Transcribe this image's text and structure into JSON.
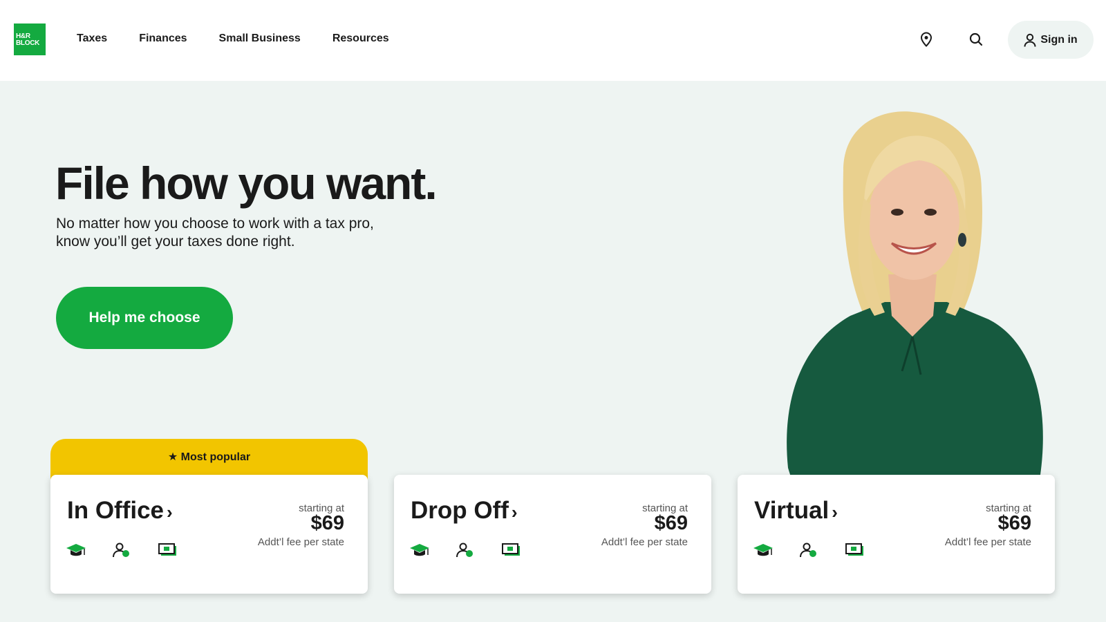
{
  "brand": {
    "logo_line1": "H&R",
    "logo_line2": "BLOCK",
    "green": "#14aa40",
    "yellow": "#f2c500",
    "hero_bg": "#eef4f2"
  },
  "nav": {
    "items": [
      "Taxes",
      "Finances",
      "Small Business",
      "Resources"
    ]
  },
  "header": {
    "location_icon": "location-pin-icon",
    "search_icon": "search-icon",
    "signin_label": "Sign in",
    "signin_icon": "user-icon"
  },
  "hero": {
    "headline": "File how you want.",
    "subtext": "No matter how you choose to work with a tax pro, know you’ll get your taxes done right.",
    "cta_label": "Help me choose"
  },
  "badge": {
    "label": "Most popular",
    "icon": "star-icon"
  },
  "cards": [
    {
      "title": "In Office",
      "starting": "starting at",
      "price": "$69",
      "fee": "Addt’l fee per state"
    },
    {
      "title": "Drop Off",
      "starting": "starting at",
      "price": "$69",
      "fee": "Addt’l fee per state"
    },
    {
      "title": "Virtual",
      "starting": "starting at",
      "price": "$69",
      "fee": "Addt’l fee per state"
    }
  ],
  "card_icons": [
    "graduation-cap-icon",
    "person-icon",
    "money-icon"
  ]
}
